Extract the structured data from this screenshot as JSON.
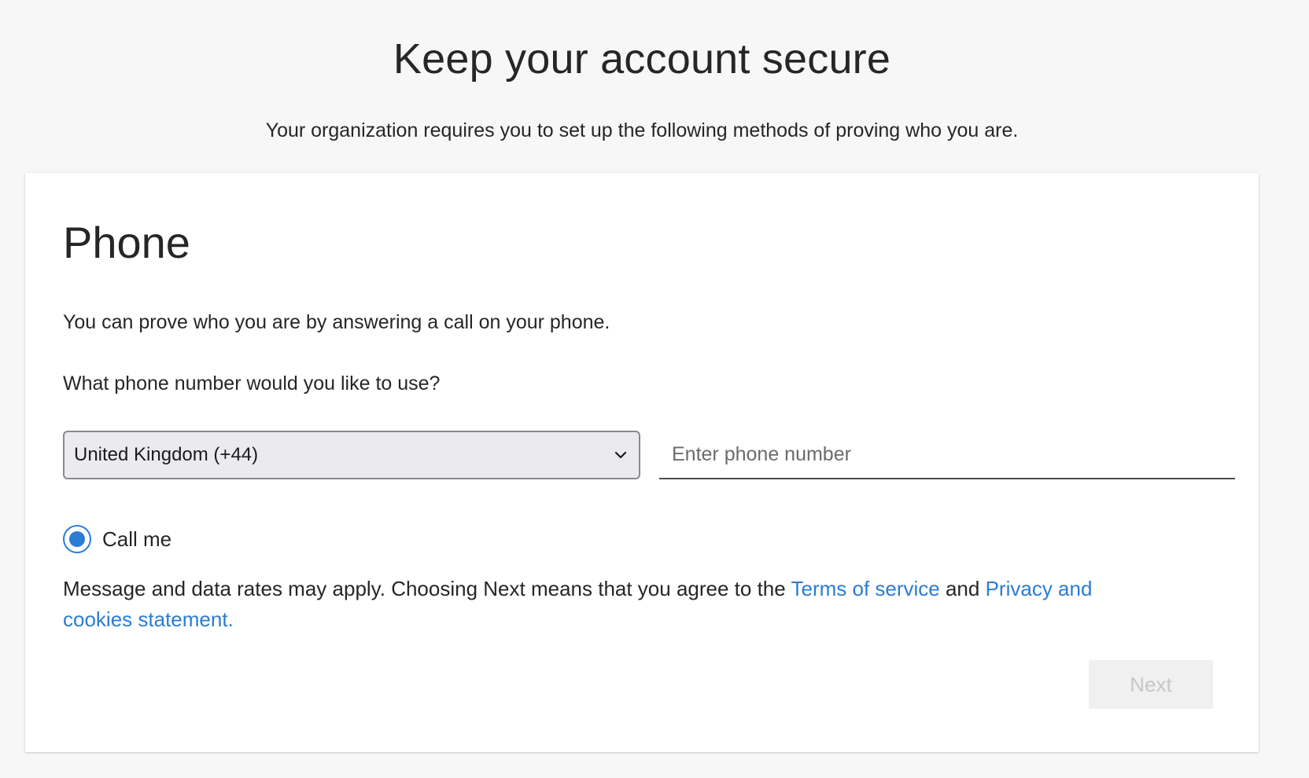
{
  "header": {
    "title": "Keep your account secure",
    "subtitle": "Your organization requires you to set up the following methods of proving who you are."
  },
  "card": {
    "title": "Phone",
    "intro": "You can prove who you are by answering a call on your phone.",
    "question": "What phone number would you like to use?",
    "country_select": {
      "value": "United Kingdom (+44)",
      "icon": "chevron-down-icon"
    },
    "phone_input": {
      "value": "",
      "placeholder": "Enter phone number"
    },
    "method_option": {
      "label": "Call me",
      "selected": true
    },
    "disclaimer": {
      "text_before": "Message and data rates may apply. Choosing Next means that you agree to the ",
      "terms_link": "Terms of service",
      "text_middle": " and ",
      "privacy_link": "Privacy and cookies statement.",
      "link_color": "#2b7cd3"
    },
    "next_button": {
      "label": "Next",
      "disabled": true
    }
  }
}
